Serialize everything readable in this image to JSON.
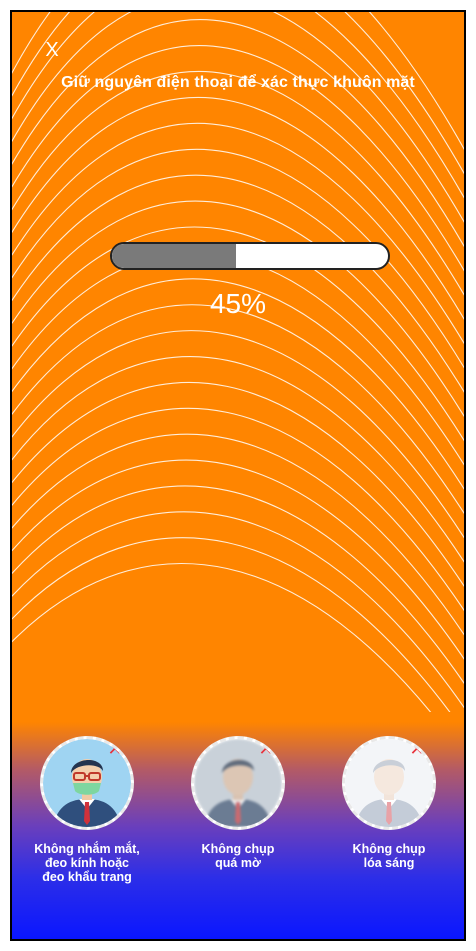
{
  "screen": {
    "close_label": "X",
    "instruction": "Giữ nguyên điện thoại để xác thực khuôn mặt"
  },
  "progress": {
    "percent": 45,
    "label": "45%"
  },
  "tips": [
    {
      "label": "Không nhắm mắt,\nđeo kính hoặc\nđeo khẩu trang",
      "style": "glasses-mask",
      "icon": "face-with-glasses-mask-icon"
    },
    {
      "label": "Không chụp\nquá mờ",
      "style": "blurry",
      "icon": "blurry-face-icon"
    },
    {
      "label": "Không chụp\nlóa sáng",
      "style": "overexposed",
      "icon": "overexposed-face-icon"
    }
  ],
  "colors": {
    "background_top": "#ff8500",
    "background_bottom": "#0a16ff",
    "progress_fill": "#7a7a7a",
    "badge_red": "#e8323c"
  }
}
